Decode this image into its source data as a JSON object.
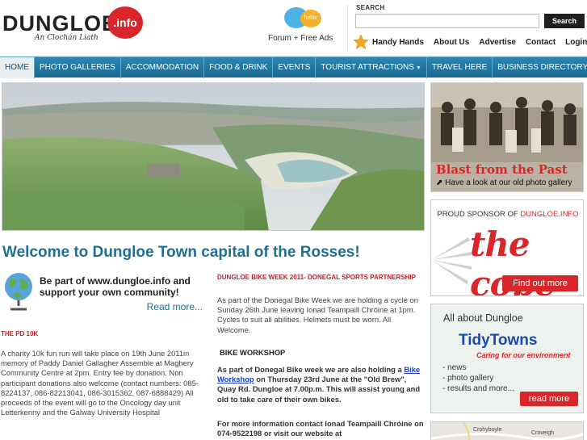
{
  "header": {
    "logo_word": "DUNGLOE",
    "logo_badge": ".info",
    "logo_tagline": "An Clochán Liath",
    "forum_bubble": "hello!",
    "forum_label": "Forum + Free Ads",
    "search": {
      "label": "SEARCH",
      "placeholder": "",
      "button": "Search"
    },
    "links": [
      "Handy Hands",
      "About Us",
      "Advertise",
      "Contact",
      "Login"
    ]
  },
  "nav": {
    "items": [
      {
        "label": "HOME",
        "dropdown": false
      },
      {
        "label": "PHOTO GALLERIES",
        "dropdown": false
      },
      {
        "label": "ACCOMMODATION",
        "dropdown": false
      },
      {
        "label": "FOOD & DRINK",
        "dropdown": false
      },
      {
        "label": "EVENTS",
        "dropdown": false
      },
      {
        "label": "TOURIST ATTRACTIONS",
        "dropdown": true
      },
      {
        "label": "TRAVEL HERE",
        "dropdown": false
      },
      {
        "label": "BUSINESS DIRECTORY",
        "dropdown": true
      }
    ]
  },
  "main": {
    "welcome": "Welcome to Dungloe Town capital of the Rosses!",
    "promo": {
      "line1": "Be part of www.dungloe.info and",
      "line2": "support your own community!",
      "more": "Read more..."
    },
    "pd": {
      "heading": "THE PD 10K",
      "body": "A charity 10k fun run will take place on 19th June 2011in memory of Paddy Daniel Gallagher Assemble at Maghery Community Centre at 2pm. Entry fee by donation. Non participant donations also welcome (contact numbers: 085-8224137, 086-82213041, 086-3015362, 087-6888429) All proceeds of the event will go to the Oncology day unit Letterkenny and the Galway University Hospital"
    },
    "bike": {
      "heading": "DUNGLOE BIKE WEEK 2011- DONEGAL SPORTS PARTNERSHIP",
      "body": "As part of the Donegal Bike Week we are holding a cycle on Sunday 26th June leaving Ionad Teampaill Chróine at 1pm.  Cycles to suit all abilities.  Helmets must be worn. All Welcome.",
      "workshop_heading": "BIKE WORKSHOP",
      "workshop_pre": "As part of Donegal Bike week we are also holding a ",
      "workshop_link": "Bike Workshop",
      "workshop_post": " on Thursday 23rd June at the \"Old Brew\", Quay Rd. Dungloe at 7.00p.m.  This will assist young and old to take care of their own bikes.",
      "contact": "For more information contact Ionad Teampaill Chróine on 074-9522198 or visit our website at"
    }
  },
  "sidebar": {
    "blast": {
      "title": "Blast from the Past",
      "subtitle": "Have a look at our old photo gallery"
    },
    "cope": {
      "sponsor_prefix": "PROUD SPONSOR OF ",
      "sponsor_site": "DUNGLOE.INFO",
      "logo": "the cope",
      "button": "Find out more"
    },
    "tidy": {
      "title": "All about Dungloe",
      "brand": "TidyTowns",
      "tagline": "Caring for our environment",
      "items": [
        "- news",
        "- photo gallery",
        "- results and more..."
      ],
      "button": "read more"
    },
    "map": {
      "label1": "Crohyboyle",
      "label2": "Croveigh"
    }
  },
  "colors": {
    "nav_bg": "#1f77a1",
    "accent_red": "#d8262b",
    "link_blue": "#1e6f93"
  }
}
